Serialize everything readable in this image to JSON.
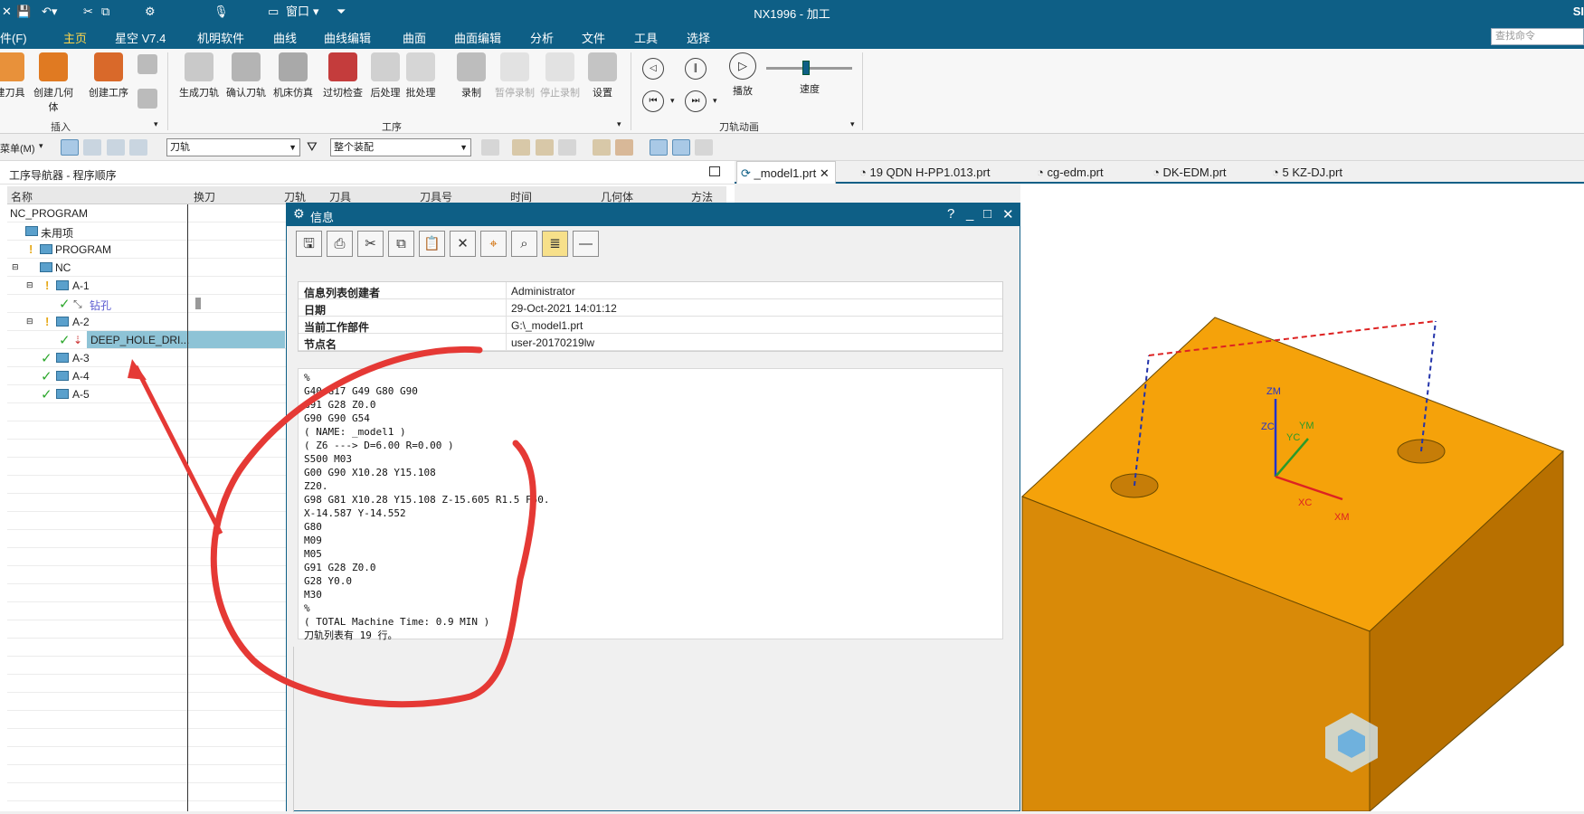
{
  "window": {
    "title": "NX1996 - 加工",
    "brand": "SI"
  },
  "quick_access": {
    "window_menu": "窗口"
  },
  "menu": {
    "file": "件(F)",
    "tabs": [
      "主页",
      "星空 V7.4",
      "机明软件",
      "曲线",
      "曲线编辑",
      "曲面",
      "曲面编辑",
      "分析",
      "文件",
      "工具",
      "选择"
    ],
    "search_placeholder": "查找命令"
  },
  "ribbon": {
    "insert_buttons": [
      "建刀具",
      "创建几何体",
      "创建工序"
    ],
    "insert_group": "插入",
    "operation_buttons": [
      "生成刀轨",
      "确认刀轨",
      "机床仿真",
      "过切检查",
      "后处理",
      "批处理",
      "录制",
      "暂停录制",
      "停止录制",
      "设置"
    ],
    "operation_group": "工序",
    "anim_buttons": [
      "播放"
    ],
    "speed_label": "速度",
    "speed_value": 0.5,
    "anim_group": "刀轨动画"
  },
  "toolbar": {
    "menu_label": "菜单(M)",
    "filter_combo": "刀轨",
    "assembly_combo": "整个装配"
  },
  "navigator": {
    "title": "工序导航器 - 程序顺序",
    "columns": [
      "名称",
      "换刀",
      "刀轨",
      "刀具",
      "刀具号",
      "时间",
      "几何体",
      "方法"
    ],
    "rows": [
      {
        "label": "NC_PROGRAM"
      },
      {
        "label": "未用项"
      },
      {
        "label": "PROGRAM"
      },
      {
        "label": "NC"
      },
      {
        "label": "A-1"
      },
      {
        "label": "钻孔"
      },
      {
        "label": "A-2"
      },
      {
        "label": "DEEP_HOLE_DRI..."
      },
      {
        "label": "A-3"
      },
      {
        "label": "A-4"
      },
      {
        "label": "A-5"
      }
    ]
  },
  "info_dialog": {
    "title": "信息",
    "controls": [
      "?",
      "_",
      "□",
      "✕"
    ],
    "fields": [
      {
        "key": "信息列表创建者",
        "value": "Administrator"
      },
      {
        "key": "日期",
        "value": "29-Oct-2021 14:01:12"
      },
      {
        "key": "当前工作部件",
        "value": "G:\\_model1.prt"
      },
      {
        "key": "节点名",
        "value": "user-20170219lw"
      }
    ],
    "code": "%\nG40 G17 G49 G80 G90\nG91 G28 Z0.0\nG90 G90 G54\n( NAME: _model1 )\n( Z6 ---> D=6.00 R=0.00 )\nS500 M03\nG00 G90 X10.28 Y15.108\nZ20.\nG98 G81 X10.28 Y15.108 Z-15.605 R1.5 F50.\nX-14.587 Y-14.552\nG80\nM09\nM05\nG91 G28 Z0.0\nG28 Y0.0\nM30\n%\n( TOTAL Machine Time: 0.9 MIN )\n刀轨列表有 19 行。"
  },
  "part_tabs": [
    "_model1.prt",
    "19 QDN H-PP1.013.prt",
    "cg-edm.prt",
    "DK-EDM.prt",
    "5 KZ-DJ.prt"
  ],
  "viewport": {
    "axis_labels": {
      "zm": "ZM",
      "zc": "ZC",
      "yc": "YC",
      "ym": "YM",
      "xc": "XC",
      "xm": "XM"
    },
    "part_color": "#f5a20a"
  },
  "colors": {
    "accent": "#0e5f86",
    "highlight": "#ffd54a",
    "selection": "#8ec3d6",
    "annotation": "#e53935"
  }
}
